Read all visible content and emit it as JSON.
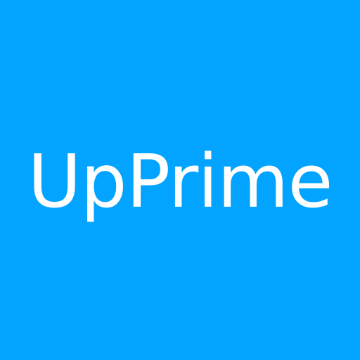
{
  "icon": {
    "label": "UpPrime",
    "background_color": "#03A4FF",
    "text_color": "#FFFFFF"
  }
}
